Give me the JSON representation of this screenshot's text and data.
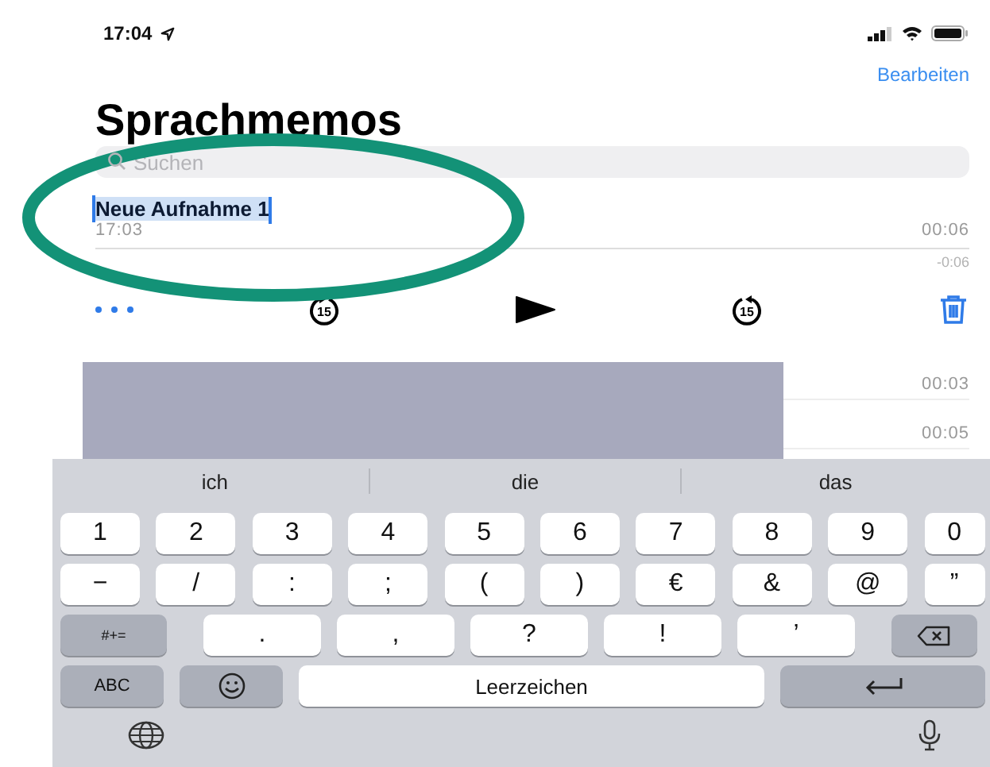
{
  "status_bar": {
    "time": "17:04"
  },
  "nav": {
    "edit_button": "Bearbeiten"
  },
  "title": "Sprachmemos",
  "search": {
    "placeholder": "Suchen"
  },
  "recordings": [
    {
      "kind": "expanded",
      "title": "Neue Aufnahme 1",
      "title_selected": true,
      "date": "17:03",
      "duration": "00:06",
      "remaining": "-0:06"
    },
    {
      "kind": "collapsed",
      "duration": "00:03"
    },
    {
      "kind": "collapsed",
      "duration": "00:05"
    }
  ],
  "player": {
    "skip_back": "15",
    "skip_forward": "15"
  },
  "keyboard": {
    "suggestions": [
      "ich",
      "die",
      "das"
    ],
    "number_row": [
      "1",
      "2",
      "3",
      "4",
      "5",
      "6",
      "7",
      "8",
      "9",
      "0"
    ],
    "symbol_row": [
      "−",
      "/",
      ":",
      ";",
      "(",
      ")",
      "€",
      "&",
      "@",
      "”"
    ],
    "more_symbols_key": "#+=",
    "punctuation_row": [
      ".",
      ",",
      "?",
      "!",
      "’"
    ],
    "abc_key": "ABC",
    "space_key": "Leerzeichen"
  }
}
